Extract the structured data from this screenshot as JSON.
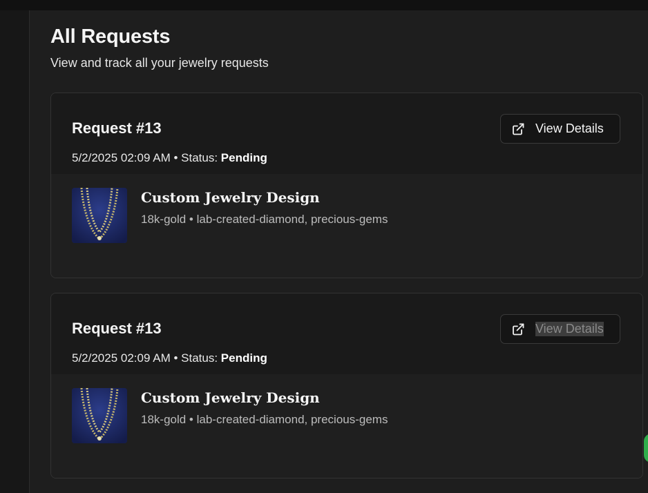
{
  "page": {
    "title": "All Requests",
    "subtitle": "View and track all your jewelry requests"
  },
  "requests": [
    {
      "title": "Request #13",
      "date": "5/2/2025 02:09 AM",
      "separator": " • ",
      "status_label": "Status:",
      "status_value": "Pending",
      "button_label": "View Details",
      "button_icon": "external-link-icon",
      "item": {
        "name": "Custom Jewelry Design",
        "specs": "18k-gold • lab-created-diamond, precious-gems",
        "thumbnail": "necklace-image"
      }
    },
    {
      "title": "Request #13",
      "date": "5/2/2025 02:09 AM",
      "separator": " • ",
      "status_label": "Status:",
      "status_value": "Pending",
      "button_label": "View Details",
      "button_label_selected": true,
      "button_icon": "external-link-icon",
      "item": {
        "name": "Custom Jewelry Design",
        "specs": "18k-gold • lab-created-diamond, precious-gems",
        "thumbnail": "necklace-image"
      }
    }
  ],
  "colors": {
    "background": "#1e1e1e",
    "card_border": "#333333",
    "text_primary": "#f5f5f5",
    "text_muted": "#bcbcbc",
    "thumbnail_backdrop": "#1f2a63",
    "accent_green": "#2fae4b"
  }
}
